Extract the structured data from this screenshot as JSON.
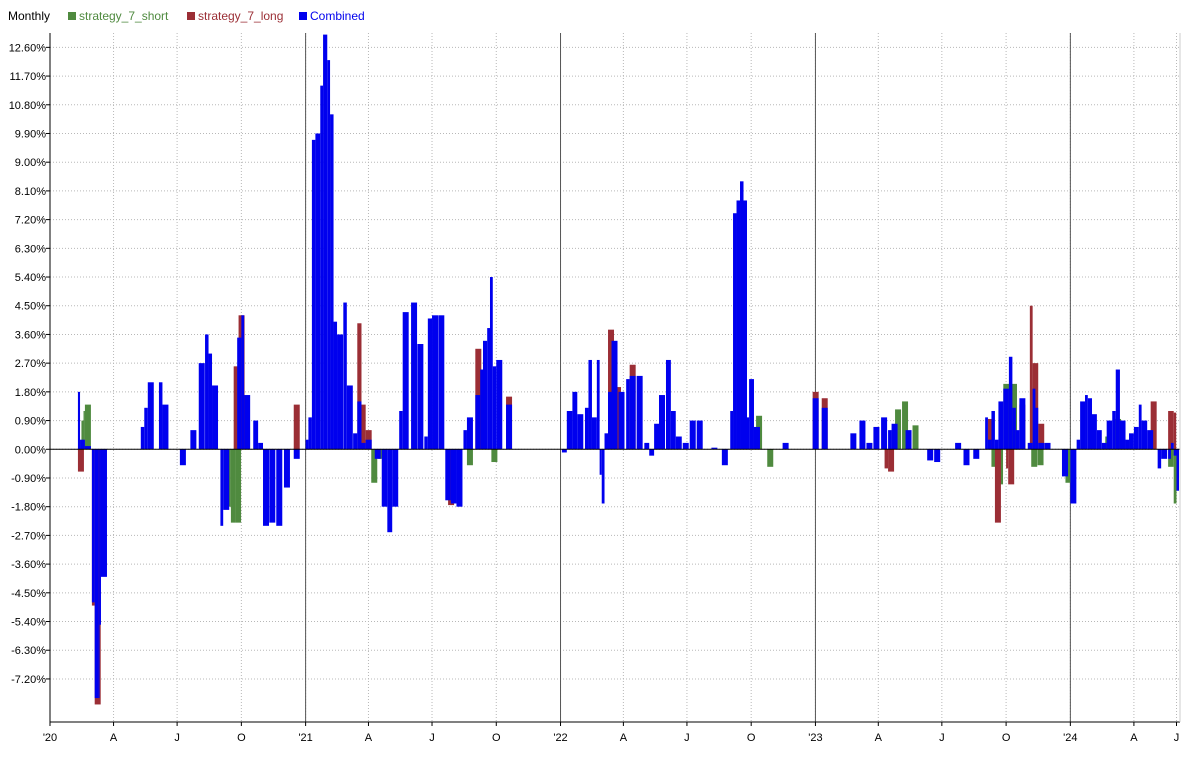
{
  "chart_data": {
    "type": "bar",
    "title": "Monthly",
    "legend_position": "top-left",
    "grid": true,
    "y_unit": "%",
    "ylim": [
      -8.55,
      13.05
    ],
    "y_ticks": [
      12.6,
      11.7,
      10.8,
      9.9,
      9.0,
      8.1,
      7.2,
      6.3,
      5.4,
      4.5,
      3.6,
      2.7,
      1.8,
      0.9,
      0.0,
      -0.9,
      -1.8,
      -2.7,
      -3.6,
      -4.5,
      -5.4,
      -6.3,
      -7.2
    ],
    "y_tick_labels": [
      "12.60%",
      "11.70%",
      "10.80%",
      "9.90%",
      "9.00%",
      "8.10%",
      "7.20%",
      "6.30%",
      "5.40%",
      "4.50%",
      "3.60%",
      "2.70%",
      "1.80%",
      "0.90%",
      "0.00%",
      "-0.90%",
      "-1.80%",
      "-2.70%",
      "-3.60%",
      "-4.50%",
      "-5.40%",
      "-6.30%",
      "-7.20%"
    ],
    "xlim": [
      "2020-01-01",
      "2024-06-06"
    ],
    "x_ticks": [
      "2020-01-01",
      "2020-04-01",
      "2020-07-01",
      "2020-10-01",
      "2021-01-01",
      "2021-04-01",
      "2021-07-01",
      "2021-10-01",
      "2022-01-01",
      "2022-04-01",
      "2022-07-01",
      "2022-10-01",
      "2023-01-01",
      "2023-04-01",
      "2023-07-01",
      "2023-10-01",
      "2024-01-01",
      "2024-04-01",
      "2024-06-01"
    ],
    "x_tick_labels": [
      "'20",
      "A",
      "J",
      "O",
      "'21",
      "A",
      "J",
      "O",
      "'22",
      "A",
      "J",
      "O",
      "'23",
      "A",
      "J",
      "O",
      "'24",
      "A",
      "J"
    ],
    "year_lines": [
      "2021-01-01",
      "2022-01-01",
      "2023-01-01",
      "2024-01-01"
    ],
    "series": [
      {
        "name": "strategy_7_short",
        "color": "#4f8a3f",
        "points": [
          [
            "2020-02-15",
            0.9
          ],
          [
            "2020-02-18",
            1.2
          ],
          [
            "2020-02-20",
            1.4
          ],
          [
            "2020-09-10",
            -1.8
          ],
          [
            "2020-09-16",
            -2.3
          ],
          [
            "2020-09-22",
            -2.3
          ],
          [
            "2021-04-05",
            -1.05
          ],
          [
            "2021-04-15",
            -0.3
          ],
          [
            "2021-08-20",
            -0.5
          ],
          [
            "2021-09-24",
            -0.4
          ],
          [
            "2022-10-24",
            -0.55
          ],
          [
            "2022-10-08",
            1.05
          ],
          [
            "2023-04-25",
            1.25
          ],
          [
            "2023-05-05",
            1.5
          ],
          [
            "2023-05-20",
            0.75
          ],
          [
            "2023-09-10",
            -0.55
          ],
          [
            "2023-09-18",
            -1.1
          ],
          [
            "2023-09-27",
            2.05
          ],
          [
            "2023-10-08",
            2.05
          ],
          [
            "2023-11-06",
            -0.55
          ],
          [
            "2023-11-15",
            -0.5
          ],
          [
            "2023-12-25",
            -1.05
          ],
          [
            "2024-02-20",
            0.4
          ],
          [
            "2024-03-05",
            0.95
          ],
          [
            "2024-05-20",
            -0.55
          ],
          [
            "2024-05-28",
            -1.7
          ],
          [
            "2024-06-01",
            -0.9
          ]
        ]
      },
      {
        "name": "strategy_7_long",
        "color": "#9b2e35",
        "points": [
          [
            "2020-02-10",
            -0.7
          ],
          [
            "2020-03-01",
            -4.9
          ],
          [
            "2020-03-05",
            -8.0
          ],
          [
            "2020-09-20",
            2.6
          ],
          [
            "2020-09-27",
            4.2
          ],
          [
            "2020-12-15",
            1.4
          ],
          [
            "2021-03-16",
            3.95
          ],
          [
            "2021-03-22",
            1.4
          ],
          [
            "2021-03-28",
            0.6
          ],
          [
            "2021-07-24",
            -1.75
          ],
          [
            "2021-09-01",
            3.15
          ],
          [
            "2021-10-15",
            1.65
          ],
          [
            "2022-03-10",
            3.75
          ],
          [
            "2022-03-20",
            1.95
          ],
          [
            "2022-04-10",
            2.65
          ],
          [
            "2022-09-16",
            1.5
          ],
          [
            "2022-12-28",
            1.8
          ],
          [
            "2023-01-10",
            1.6
          ],
          [
            "2023-04-10",
            -0.6
          ],
          [
            "2023-04-15",
            -0.7
          ],
          [
            "2023-09-05",
            0.95
          ],
          [
            "2023-09-15",
            -2.3
          ],
          [
            "2023-10-01",
            -0.6
          ],
          [
            "2023-10-04",
            -1.1
          ],
          [
            "2023-10-20",
            1.4
          ],
          [
            "2023-11-04",
            4.5
          ],
          [
            "2023-11-08",
            2.7
          ],
          [
            "2023-11-16",
            0.8
          ],
          [
            "2024-04-25",
            1.5
          ],
          [
            "2024-05-20",
            1.2
          ],
          [
            "2024-05-28",
            1.15
          ]
        ]
      },
      {
        "name": "Combined",
        "color": "#0000ee",
        "points": [
          [
            "2020-02-10",
            1.8
          ],
          [
            "2020-02-13",
            0.3
          ],
          [
            "2020-02-20",
            0.1
          ],
          [
            "2020-03-01",
            -4.8
          ],
          [
            "2020-03-05",
            -7.8
          ],
          [
            "2020-03-10",
            -7.8
          ],
          [
            "2020-03-12",
            -5.5
          ],
          [
            "2020-03-14",
            -4.0
          ],
          [
            "2020-05-10",
            0.7
          ],
          [
            "2020-05-15",
            1.3
          ],
          [
            "2020-05-20",
            2.1
          ],
          [
            "2020-06-05",
            2.1
          ],
          [
            "2020-06-10",
            1.4
          ],
          [
            "2020-07-05",
            -0.5
          ],
          [
            "2020-07-20",
            0.6
          ],
          [
            "2020-08-01",
            2.7
          ],
          [
            "2020-08-10",
            3.6
          ],
          [
            "2020-08-15",
            3.0
          ],
          [
            "2020-08-20",
            2.0
          ],
          [
            "2020-09-01",
            -2.4
          ],
          [
            "2020-09-05",
            -1.9
          ],
          [
            "2020-09-25",
            3.5
          ],
          [
            "2020-10-01",
            4.2
          ],
          [
            "2020-10-05",
            1.7
          ],
          [
            "2020-10-18",
            0.9
          ],
          [
            "2020-10-25",
            0.2
          ],
          [
            "2020-11-01",
            -2.4
          ],
          [
            "2020-11-10",
            -2.3
          ],
          [
            "2020-11-20",
            -2.4
          ],
          [
            "2020-12-01",
            -1.2
          ],
          [
            "2020-12-15",
            -0.3
          ],
          [
            "2021-01-01",
            0.3
          ],
          [
            "2021-01-05",
            1.0
          ],
          [
            "2021-01-10",
            9.7
          ],
          [
            "2021-01-15",
            9.9
          ],
          [
            "2021-01-22",
            11.4
          ],
          [
            "2021-01-26",
            13.0
          ],
          [
            "2021-02-01",
            12.2
          ],
          [
            "2021-02-05",
            10.5
          ],
          [
            "2021-02-10",
            4.0
          ],
          [
            "2021-02-15",
            3.6
          ],
          [
            "2021-02-24",
            4.6
          ],
          [
            "2021-03-01",
            2.0
          ],
          [
            "2021-03-10",
            0.5
          ],
          [
            "2021-03-16",
            1.5
          ],
          [
            "2021-03-22",
            0.2
          ],
          [
            "2021-03-28",
            0.3
          ],
          [
            "2021-04-10",
            -0.3
          ],
          [
            "2021-04-20",
            -1.8
          ],
          [
            "2021-04-28",
            -2.6
          ],
          [
            "2021-05-05",
            -1.8
          ],
          [
            "2021-05-15",
            1.2
          ],
          [
            "2021-05-20",
            4.3
          ],
          [
            "2021-06-01",
            4.6
          ],
          [
            "2021-06-10",
            3.3
          ],
          [
            "2021-06-20",
            0.4
          ],
          [
            "2021-06-25",
            4.1
          ],
          [
            "2021-07-01",
            4.2
          ],
          [
            "2021-07-10",
            4.2
          ],
          [
            "2021-07-20",
            -1.6
          ],
          [
            "2021-07-28",
            -1.7
          ],
          [
            "2021-08-05",
            -1.8
          ],
          [
            "2021-08-15",
            0.6
          ],
          [
            "2021-08-20",
            1.0
          ],
          [
            "2021-09-01",
            1.7
          ],
          [
            "2021-09-08",
            2.5
          ],
          [
            "2021-09-12",
            3.4
          ],
          [
            "2021-09-18",
            3.8
          ],
          [
            "2021-09-22",
            5.4
          ],
          [
            "2021-09-26",
            2.6
          ],
          [
            "2021-10-01",
            2.8
          ],
          [
            "2021-10-15",
            1.4
          ],
          [
            "2022-01-03",
            -0.1
          ],
          [
            "2022-01-10",
            1.2
          ],
          [
            "2022-01-18",
            1.8
          ],
          [
            "2022-01-25",
            1.1
          ],
          [
            "2022-02-05",
            1.3
          ],
          [
            "2022-02-10",
            2.8
          ],
          [
            "2022-02-15",
            1.0
          ],
          [
            "2022-02-22",
            2.8
          ],
          [
            "2022-02-26",
            -0.8
          ],
          [
            "2022-03-01",
            -1.7
          ],
          [
            "2022-03-05",
            0.5
          ],
          [
            "2022-03-10",
            1.8
          ],
          [
            "2022-03-15",
            3.4
          ],
          [
            "2022-03-25",
            1.8
          ],
          [
            "2022-04-05",
            2.2
          ],
          [
            "2022-04-10",
            2.3
          ],
          [
            "2022-04-20",
            2.3
          ],
          [
            "2022-05-01",
            0.2
          ],
          [
            "2022-05-08",
            -0.2
          ],
          [
            "2022-05-15",
            0.8
          ],
          [
            "2022-05-22",
            1.7
          ],
          [
            "2022-06-01",
            2.8
          ],
          [
            "2022-06-08",
            1.2
          ],
          [
            "2022-06-15",
            0.4
          ],
          [
            "2022-06-25",
            0.2
          ],
          [
            "2022-07-05",
            0.9
          ],
          [
            "2022-07-15",
            0.9
          ],
          [
            "2022-08-05",
            0.05
          ],
          [
            "2022-08-20",
            -0.5
          ],
          [
            "2022-09-01",
            1.2
          ],
          [
            "2022-09-05",
            7.4
          ],
          [
            "2022-09-10",
            7.8
          ],
          [
            "2022-09-15",
            8.4
          ],
          [
            "2022-09-20",
            7.8
          ],
          [
            "2022-09-25",
            1.0
          ],
          [
            "2022-09-28",
            2.2
          ],
          [
            "2022-10-05",
            0.7
          ],
          [
            "2022-11-15",
            0.2
          ],
          [
            "2022-12-28",
            1.6
          ],
          [
            "2023-01-10",
            1.3
          ],
          [
            "2023-02-20",
            0.5
          ],
          [
            "2023-03-05",
            0.9
          ],
          [
            "2023-03-15",
            0.2
          ],
          [
            "2023-03-25",
            0.7
          ],
          [
            "2023-04-05",
            1.0
          ],
          [
            "2023-04-15",
            0.6
          ],
          [
            "2023-04-20",
            0.8
          ],
          [
            "2023-05-10",
            0.6
          ],
          [
            "2023-06-10",
            -0.35
          ],
          [
            "2023-06-20",
            -0.4
          ],
          [
            "2023-07-20",
            0.2
          ],
          [
            "2023-08-01",
            -0.5
          ],
          [
            "2023-08-15",
            -0.3
          ],
          [
            "2023-09-01",
            1.0
          ],
          [
            "2023-09-05",
            0.3
          ],
          [
            "2023-09-10",
            1.2
          ],
          [
            "2023-09-15",
            0.3
          ],
          [
            "2023-09-20",
            1.5
          ],
          [
            "2023-09-27",
            1.9
          ],
          [
            "2023-10-05",
            2.9
          ],
          [
            "2023-10-10",
            1.3
          ],
          [
            "2023-10-15",
            0.6
          ],
          [
            "2023-10-20",
            1.6
          ],
          [
            "2023-11-01",
            0.2
          ],
          [
            "2023-11-08",
            1.9
          ],
          [
            "2023-11-12",
            1.3
          ],
          [
            "2023-11-16",
            0.2
          ],
          [
            "2023-11-25",
            0.2
          ],
          [
            "2023-12-20",
            -0.85
          ],
          [
            "2024-01-01",
            -1.7
          ],
          [
            "2024-01-10",
            0.3
          ],
          [
            "2024-01-15",
            1.5
          ],
          [
            "2024-01-22",
            1.7
          ],
          [
            "2024-01-26",
            1.6
          ],
          [
            "2024-02-01",
            1.1
          ],
          [
            "2024-02-08",
            0.6
          ],
          [
            "2024-02-15",
            0.2
          ],
          [
            "2024-02-22",
            0.9
          ],
          [
            "2024-03-01",
            1.2
          ],
          [
            "2024-03-06",
            2.5
          ],
          [
            "2024-03-12",
            0.9
          ],
          [
            "2024-03-20",
            0.3
          ],
          [
            "2024-03-25",
            0.5
          ],
          [
            "2024-04-01",
            0.7
          ],
          [
            "2024-04-08",
            1.4
          ],
          [
            "2024-04-12",
            0.9
          ],
          [
            "2024-04-20",
            0.6
          ],
          [
            "2024-05-05",
            -0.6
          ],
          [
            "2024-05-10",
            -0.3
          ],
          [
            "2024-05-20",
            -0.3
          ],
          [
            "2024-05-24",
            0.2
          ],
          [
            "2024-05-28",
            -0.2
          ],
          [
            "2024-06-01",
            -1.3
          ]
        ]
      }
    ]
  }
}
